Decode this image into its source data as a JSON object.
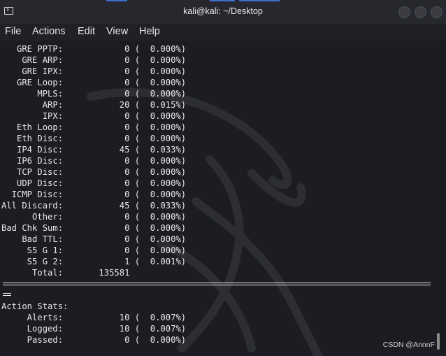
{
  "window": {
    "title": "kali@kali: ~/Desktop",
    "accent_color": "#3f6fd1"
  },
  "menubar": {
    "items": [
      {
        "label": "File"
      },
      {
        "label": "Actions"
      },
      {
        "label": "Edit"
      },
      {
        "label": "View"
      },
      {
        "label": "Help"
      }
    ]
  },
  "terminal": {
    "rows": [
      {
        "text": "   GRE PPTP:            0 (  0.000%)"
      },
      {
        "text": "    GRE ARP:            0 (  0.000%)"
      },
      {
        "text": "    GRE IPX:            0 (  0.000%)"
      },
      {
        "text": "   GRE Loop:            0 (  0.000%)"
      },
      {
        "text": "       MPLS:            0 (  0.000%)"
      },
      {
        "text": "        ARP:           20 (  0.015%)"
      },
      {
        "text": "        IPX:            0 (  0.000%)"
      },
      {
        "text": "   Eth Loop:            0 (  0.000%)"
      },
      {
        "text": "   Eth Disc:            0 (  0.000%)"
      },
      {
        "text": "   IP4 Disc:           45 (  0.033%)"
      },
      {
        "text": "   IP6 Disc:            0 (  0.000%)"
      },
      {
        "text": "   TCP Disc:            0 (  0.000%)"
      },
      {
        "text": "   UDP Disc:            0 (  0.000%)"
      },
      {
        "text": "  ICMP Disc:            0 (  0.000%)"
      },
      {
        "text": "All Discard:           45 (  0.033%)"
      },
      {
        "text": "      Other:            0 (  0.000%)"
      },
      {
        "text": "Bad Chk Sum:            0 (  0.000%)"
      },
      {
        "text": "    Bad TTL:            0 (  0.000%)"
      },
      {
        "text": "     S5 G 1:            0 (  0.000%)"
      },
      {
        "text": "     S5 G 2:            1 (  0.001%)"
      },
      {
        "text": "      Total:       135581"
      }
    ],
    "rows2": [
      {
        "text": "Action Stats:"
      },
      {
        "text": "     Alerts:           10 (  0.007%)"
      },
      {
        "text": "     Logged:           10 (  0.007%)"
      },
      {
        "text": "     Passed:            0 (  0.000%)"
      }
    ]
  },
  "watermark": {
    "text": "CSDN @AnnnF"
  }
}
